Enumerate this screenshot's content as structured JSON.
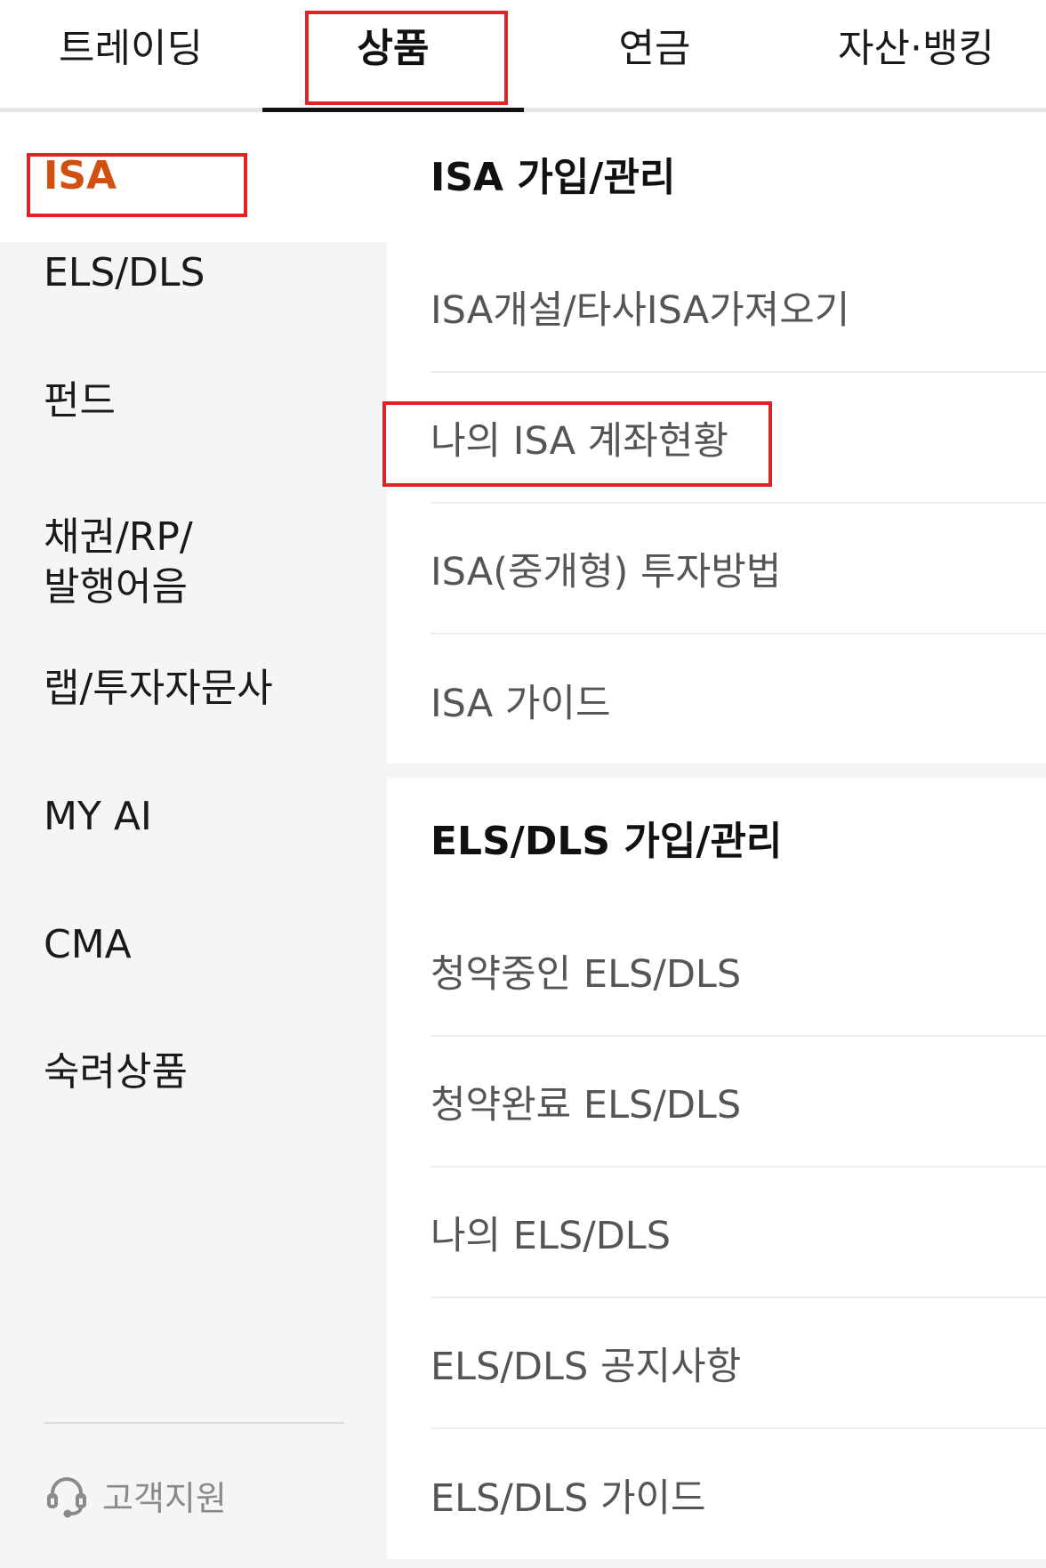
{
  "tabs": [
    {
      "label": "트레이딩"
    },
    {
      "label": "상품"
    },
    {
      "label": "연금"
    },
    {
      "label": "자산·뱅킹"
    }
  ],
  "active_tab": "상품",
  "categories": [
    {
      "label": "ISA"
    },
    {
      "label": "ELS/DLS"
    },
    {
      "label": "펀드"
    },
    {
      "label_line1": "채권/RP/",
      "label_line2": "발행어음"
    },
    {
      "label": "랩/투자자문사"
    },
    {
      "label": "MY AI"
    },
    {
      "label": "CMA"
    },
    {
      "label": "숙려상품"
    }
  ],
  "support": {
    "label": "고객지원",
    "icon": "headset-icon"
  },
  "sections": [
    {
      "title": "ISA 가입/관리",
      "items": [
        {
          "label": "ISA개설/타사ISA가져오기"
        },
        {
          "label": "나의 ISA 계좌현황"
        },
        {
          "label": "ISA(중개형) 투자방법"
        },
        {
          "label": "ISA 가이드"
        }
      ]
    },
    {
      "title": "ELS/DLS 가입/관리",
      "items": [
        {
          "label": "청약중인 ELS/DLS"
        },
        {
          "label": "청약완료 ELS/DLS"
        },
        {
          "label": "나의 ELS/DLS"
        },
        {
          "label": "ELS/DLS 공지사항"
        },
        {
          "label": "ELS/DLS 가이드"
        }
      ]
    }
  ],
  "colors": {
    "accent": "#d2500f",
    "highlight": "#e02424",
    "rail_bg": "#f4f5f7",
    "muted_text": "#555555"
  }
}
